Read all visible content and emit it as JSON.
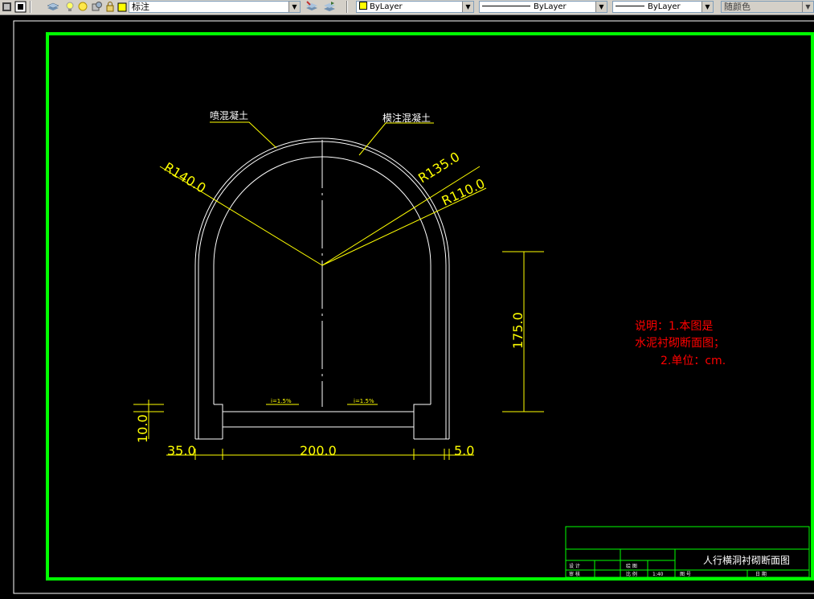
{
  "toolbar": {
    "layer_name": "标注",
    "color_value": "ByLayer",
    "linetype_value": "ByLayer",
    "lineweight_value": "ByLayer",
    "plotstyle_value": "随颜色"
  },
  "drawing": {
    "label_shotcrete": "喷混凝土",
    "label_cast_concrete": "模注混凝土",
    "dim_r140": "R140.0",
    "dim_r135": "R135.0",
    "dim_r110": "R110.0",
    "dim_175": "175.0",
    "dim_10": "10.0",
    "dim_35": "35.0",
    "dim_200": "200.0",
    "dim_5": "5.0",
    "slope_left": "i=1.5%",
    "slope_right": "i=1.5%",
    "note_line1": "说明：1.本图是",
    "note_line2": "水泥衬砌断面图；",
    "note_line3": "2.单位：cm."
  },
  "title_block": {
    "title": "人行横洞衬砌断面图",
    "design_label": "设 计",
    "drawing_label": "绘 图",
    "review_label": "审 核",
    "scale_label": "比 例",
    "scale_value": "1:40",
    "drawing_no_label": "图 号",
    "date_label": "日 期"
  },
  "colors": {
    "frame_green": "#00ff00",
    "line_white": "#ffffff",
    "dim_yellow": "#ffff00",
    "note_red": "#ff0000"
  }
}
